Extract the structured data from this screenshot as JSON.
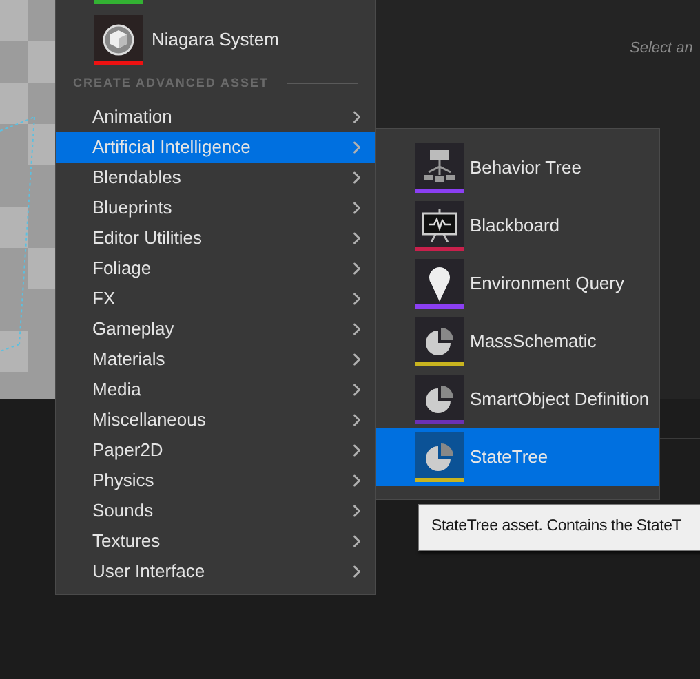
{
  "background": {
    "hint": "Select an"
  },
  "main_menu": {
    "quick_assets": [
      {
        "kind": "partial",
        "color": "#33b233"
      },
      {
        "kind": "niagara",
        "label": "Niagara System",
        "color": "#ee1111"
      }
    ],
    "section_header": "CREATE ADVANCED ASSET",
    "items": [
      {
        "label": "Animation",
        "selected": false
      },
      {
        "label": "Artificial Intelligence",
        "selected": true
      },
      {
        "label": "Blendables",
        "selected": false
      },
      {
        "label": "Blueprints",
        "selected": false
      },
      {
        "label": "Editor Utilities",
        "selected": false
      },
      {
        "label": "Foliage",
        "selected": false
      },
      {
        "label": "FX",
        "selected": false
      },
      {
        "label": "Gameplay",
        "selected": false
      },
      {
        "label": "Materials",
        "selected": false
      },
      {
        "label": "Media",
        "selected": false
      },
      {
        "label": "Miscellaneous",
        "selected": false
      },
      {
        "label": "Paper2D",
        "selected": false
      },
      {
        "label": "Physics",
        "selected": false
      },
      {
        "label": "Sounds",
        "selected": false
      },
      {
        "label": "Textures",
        "selected": false
      },
      {
        "label": "User Interface",
        "selected": false
      }
    ]
  },
  "submenu": {
    "items": [
      {
        "kind": "tree",
        "label": "Behavior Tree",
        "color": "#8b3ff2",
        "selected": false
      },
      {
        "kind": "board",
        "label": "Blackboard",
        "color": "#c8204c",
        "selected": false
      },
      {
        "kind": "pin",
        "label": "Environment Query",
        "color": "#8b3ff2",
        "selected": false
      },
      {
        "kind": "pie",
        "label": "MassSchematic",
        "color": "#c9b41f",
        "selected": false
      },
      {
        "kind": "pie",
        "label": "SmartObject Definition",
        "color": "#6b30b4",
        "selected": false
      },
      {
        "kind": "pie",
        "label": "StateTree",
        "color": "#c9b41f",
        "selected": true
      }
    ]
  },
  "tooltip": {
    "text": "StateTree asset. Contains the StateT"
  }
}
